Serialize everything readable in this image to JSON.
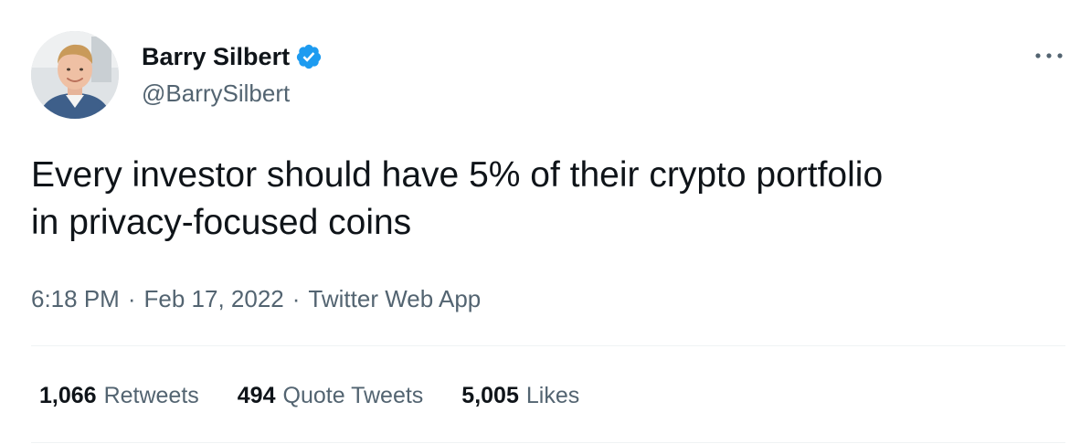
{
  "author": {
    "display_name": "Barry Silbert",
    "handle": "@BarrySilbert",
    "verified": true
  },
  "tweet": {
    "text": "Every investor should have 5% of their crypto portfolio\nin privacy-focused coins",
    "time": "6:18 PM",
    "date": "Feb 17, 2022",
    "source": "Twitter Web App",
    "separator": "·"
  },
  "stats": [
    {
      "count": "1,066",
      "label": "Retweets"
    },
    {
      "count": "494",
      "label": "Quote Tweets"
    },
    {
      "count": "5,005",
      "label": "Likes"
    }
  ],
  "icons": {
    "verified": "verified-badge-icon",
    "more": "more-horizontal-icon"
  },
  "colors": {
    "text_primary": "#0f1419",
    "text_secondary": "#536471",
    "verified_blue": "#1d9bf0",
    "divider": "#eff3f4"
  }
}
